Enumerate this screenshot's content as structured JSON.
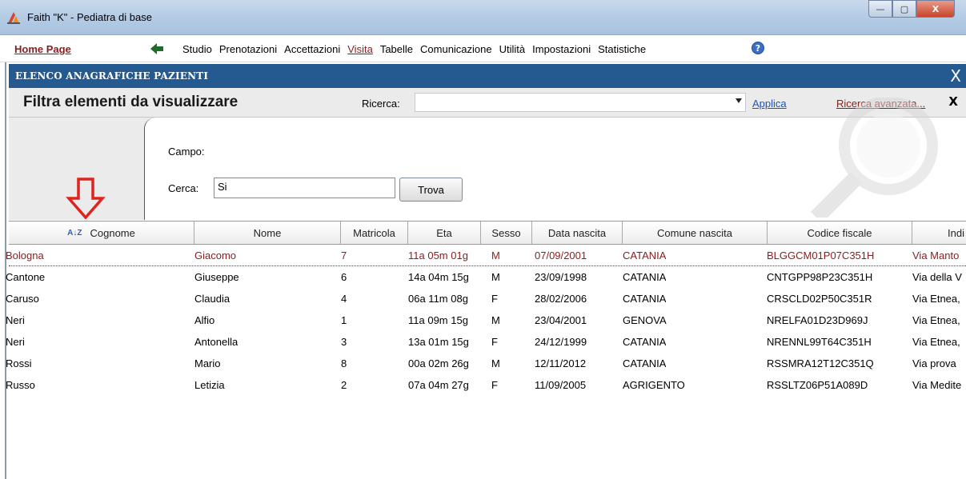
{
  "window": {
    "title": "Faith \"K\" - Pediatra di base",
    "min": "—",
    "max": "▢",
    "close": "X"
  },
  "menubar": {
    "home": "Home Page",
    "items": [
      {
        "label": "Studio",
        "active": false
      },
      {
        "label": "Prenotazioni",
        "active": false
      },
      {
        "label": "Accettazioni",
        "active": false
      },
      {
        "label": "Visita",
        "active": true
      },
      {
        "label": "Tabelle",
        "active": false
      },
      {
        "label": "Comunicazione",
        "active": false
      },
      {
        "label": "Utilità",
        "active": false
      },
      {
        "label": "Impostazioni",
        "active": false
      },
      {
        "label": "Statistiche",
        "active": false
      }
    ],
    "help": "?"
  },
  "panel": {
    "title": "ELENCO ANAGRAFICHE PAZIENTI",
    "close": "X"
  },
  "filter": {
    "title": "Filtra elementi da visualizzare",
    "search_label": "Ricerca:",
    "search_value": "",
    "apply": "Applica",
    "advanced": "Ricerca avanzata...",
    "close": "X",
    "campo_label": "Campo:",
    "cerca_label": "Cerca:",
    "cerca_value": "Si",
    "trova": "Trova"
  },
  "table": {
    "columns": [
      "Cognome",
      "Nome",
      "Matricola",
      "Eta",
      "Sesso",
      "Data nascita",
      "Comune nascita",
      "Codice fiscale",
      "Indi"
    ],
    "sort_icon": "A↓Z",
    "rows": [
      [
        "Bologna",
        "Giacomo",
        "7",
        "11a 05m 01g",
        "M",
        "07/09/2001",
        "CATANIA",
        "BLGGCM01P07C351H",
        "Via Manto"
      ],
      [
        "Cantone",
        "Giuseppe",
        "6",
        "14a 04m 15g",
        "M",
        "23/09/1998",
        "CATANIA",
        "CNTGPP98P23C351H",
        "Via della V"
      ],
      [
        "Caruso",
        "Claudia",
        "4",
        "06a 11m 08g",
        "F",
        "28/02/2006",
        "CATANIA",
        "CRSCLD02P50C351R",
        "Via Etnea,"
      ],
      [
        "Neri",
        "Alfio",
        "1",
        "11a 09m 15g",
        "M",
        "23/04/2001",
        "GENOVA",
        "NRELFA01D23D969J",
        "Via Etnea,"
      ],
      [
        "Neri",
        "Antonella",
        "3",
        "13a 01m 15g",
        "F",
        "24/12/1999",
        "CATANIA",
        "NRENNL99T64C351H",
        "Via Etnea,"
      ],
      [
        "Rossi",
        "Mario",
        "8",
        "00a 02m 26g",
        "M",
        "12/11/2012",
        "CATANIA",
        "RSSMRA12T12C351Q",
        "Via prova"
      ],
      [
        "Russo",
        "Letizia",
        "2",
        "07a 04m 27g",
        "F",
        "11/09/2005",
        "AGRIGENTO",
        "RSSLTZ06P51A089D",
        "Via Medite"
      ]
    ],
    "selected_row": 0
  },
  "colors": {
    "brand_red": "#8c1c1c",
    "header_blue": "#245a8f",
    "link_blue": "#1c55b8",
    "annotation_arrow": "#e0231c"
  }
}
